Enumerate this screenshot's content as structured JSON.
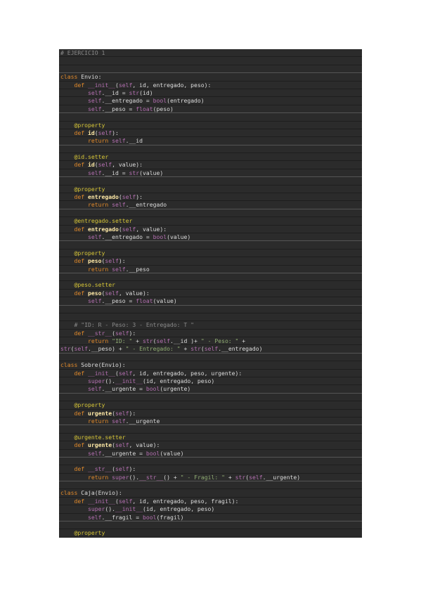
{
  "code_lines": [
    [
      {
        "t": "# EJERCICIO 1",
        "c": "cm"
      }
    ],
    [],
    [],
    [
      {
        "t": "class ",
        "c": "kw"
      },
      {
        "t": "Envio",
        "c": "txt"
      },
      {
        "t": ":",
        "c": "txt"
      }
    ],
    [
      {
        "t": "    def ",
        "c": "kw"
      },
      {
        "t": "__init__",
        "c": "dunder"
      },
      {
        "t": "(",
        "c": "txt"
      },
      {
        "t": "self",
        "c": "self"
      },
      {
        "t": ", id, entregado, peso):",
        "c": "txt"
      }
    ],
    [
      {
        "t": "        ",
        "c": "txt"
      },
      {
        "t": "self",
        "c": "self"
      },
      {
        "t": ".__id = ",
        "c": "txt"
      },
      {
        "t": "str",
        "c": "bi"
      },
      {
        "t": "(id)",
        "c": "txt"
      }
    ],
    [
      {
        "t": "        ",
        "c": "txt"
      },
      {
        "t": "self",
        "c": "self"
      },
      {
        "t": ".__entregado = ",
        "c": "txt"
      },
      {
        "t": "bool",
        "c": "bi"
      },
      {
        "t": "(entregado)",
        "c": "txt"
      }
    ],
    [
      {
        "t": "        ",
        "c": "txt"
      },
      {
        "t": "self",
        "c": "self"
      },
      {
        "t": ".__peso = ",
        "c": "txt"
      },
      {
        "t": "float",
        "c": "bi"
      },
      {
        "t": "(peso)",
        "c": "txt"
      }
    ],
    [],
    [
      {
        "t": "    @property",
        "c": "dec"
      }
    ],
    [
      {
        "t": "    def ",
        "c": "kw"
      },
      {
        "t": "id",
        "c": "fn"
      },
      {
        "t": "(",
        "c": "txt"
      },
      {
        "t": "self",
        "c": "self"
      },
      {
        "t": "):",
        "c": "txt"
      }
    ],
    [
      {
        "t": "        return ",
        "c": "kw"
      },
      {
        "t": "self",
        "c": "self"
      },
      {
        "t": ".__id",
        "c": "txt"
      }
    ],
    [],
    [
      {
        "t": "    @id.setter",
        "c": "dec"
      }
    ],
    [
      {
        "t": "    def ",
        "c": "kw"
      },
      {
        "t": "id",
        "c": "fn"
      },
      {
        "t": "(",
        "c": "txt"
      },
      {
        "t": "self",
        "c": "self"
      },
      {
        "t": ", value):",
        "c": "txt"
      }
    ],
    [
      {
        "t": "        ",
        "c": "txt"
      },
      {
        "t": "self",
        "c": "self"
      },
      {
        "t": ".__id = ",
        "c": "txt"
      },
      {
        "t": "str",
        "c": "bi"
      },
      {
        "t": "(value)",
        "c": "txt"
      }
    ],
    [],
    [
      {
        "t": "    @property",
        "c": "dec"
      }
    ],
    [
      {
        "t": "    def ",
        "c": "kw"
      },
      {
        "t": "entregado",
        "c": "fn"
      },
      {
        "t": "(",
        "c": "txt"
      },
      {
        "t": "self",
        "c": "self"
      },
      {
        "t": "):",
        "c": "txt"
      }
    ],
    [
      {
        "t": "        return ",
        "c": "kw"
      },
      {
        "t": "self",
        "c": "self"
      },
      {
        "t": ".__entregado",
        "c": "txt"
      }
    ],
    [],
    [
      {
        "t": "    @entregado.setter",
        "c": "dec"
      }
    ],
    [
      {
        "t": "    def ",
        "c": "kw"
      },
      {
        "t": "entregado",
        "c": "fn"
      },
      {
        "t": "(",
        "c": "txt"
      },
      {
        "t": "self",
        "c": "self"
      },
      {
        "t": ", value):",
        "c": "txt"
      }
    ],
    [
      {
        "t": "        ",
        "c": "txt"
      },
      {
        "t": "self",
        "c": "self"
      },
      {
        "t": ".__entregado = ",
        "c": "txt"
      },
      {
        "t": "bool",
        "c": "bi"
      },
      {
        "t": "(value)",
        "c": "txt"
      }
    ],
    [],
    [
      {
        "t": "    @property",
        "c": "dec"
      }
    ],
    [
      {
        "t": "    def ",
        "c": "kw"
      },
      {
        "t": "peso",
        "c": "fn"
      },
      {
        "t": "(",
        "c": "txt"
      },
      {
        "t": "self",
        "c": "self"
      },
      {
        "t": "):",
        "c": "txt"
      }
    ],
    [
      {
        "t": "        return ",
        "c": "kw"
      },
      {
        "t": "self",
        "c": "self"
      },
      {
        "t": ".__peso",
        "c": "txt"
      }
    ],
    [],
    [
      {
        "t": "    @peso.setter",
        "c": "dec"
      }
    ],
    [
      {
        "t": "    def ",
        "c": "kw"
      },
      {
        "t": "peso",
        "c": "fn"
      },
      {
        "t": "(",
        "c": "txt"
      },
      {
        "t": "self",
        "c": "self"
      },
      {
        "t": ", value):",
        "c": "txt"
      }
    ],
    [
      {
        "t": "        ",
        "c": "txt"
      },
      {
        "t": "self",
        "c": "self"
      },
      {
        "t": ".__peso = ",
        "c": "txt"
      },
      {
        "t": "float",
        "c": "bi"
      },
      {
        "t": "(value)",
        "c": "txt"
      }
    ],
    [],
    [],
    [
      {
        "t": "    # \"ID: R - Peso: 3 - Entregado: T \"",
        "c": "cm"
      }
    ],
    [
      {
        "t": "    def ",
        "c": "kw"
      },
      {
        "t": "__str__",
        "c": "dunder"
      },
      {
        "t": "(",
        "c": "txt"
      },
      {
        "t": "self",
        "c": "self"
      },
      {
        "t": "):",
        "c": "txt"
      }
    ],
    [
      {
        "t": "        return ",
        "c": "kw"
      },
      {
        "t": "\"ID: \"",
        "c": "str"
      },
      {
        "t": " + ",
        "c": "txt"
      },
      {
        "t": "str",
        "c": "bi"
      },
      {
        "t": "(",
        "c": "txt"
      },
      {
        "t": "self",
        "c": "self"
      },
      {
        "t": ".__id )+ ",
        "c": "txt"
      },
      {
        "t": "\" - Peso: \"",
        "c": "str"
      },
      {
        "t": " +",
        "c": "txt"
      }
    ],
    [
      {
        "t": "str",
        "c": "bi"
      },
      {
        "t": "(",
        "c": "txt"
      },
      {
        "t": "self",
        "c": "self"
      },
      {
        "t": ".__peso) + ",
        "c": "txt"
      },
      {
        "t": "\" - Entregado: \"",
        "c": "str"
      },
      {
        "t": " + ",
        "c": "txt"
      },
      {
        "t": "str",
        "c": "bi"
      },
      {
        "t": "(",
        "c": "txt"
      },
      {
        "t": "self",
        "c": "self"
      },
      {
        "t": ".__entregado)",
        "c": "txt"
      }
    ],
    [],
    [
      {
        "t": "class ",
        "c": "kw"
      },
      {
        "t": "Sobre(Envio):",
        "c": "txt"
      }
    ],
    [
      {
        "t": "    def ",
        "c": "kw"
      },
      {
        "t": "__init__",
        "c": "dunder"
      },
      {
        "t": "(",
        "c": "txt"
      },
      {
        "t": "self",
        "c": "self"
      },
      {
        "t": ", id, entregado, peso, urgente):",
        "c": "txt"
      }
    ],
    [
      {
        "t": "        ",
        "c": "txt"
      },
      {
        "t": "super",
        "c": "bi"
      },
      {
        "t": "().",
        "c": "txt"
      },
      {
        "t": "__init__",
        "c": "dunder"
      },
      {
        "t": "(id, entregado, peso)",
        "c": "txt"
      }
    ],
    [
      {
        "t": "        ",
        "c": "txt"
      },
      {
        "t": "self",
        "c": "self"
      },
      {
        "t": ".__urgente = ",
        "c": "txt"
      },
      {
        "t": "bool",
        "c": "bi"
      },
      {
        "t": "(urgente)",
        "c": "txt"
      }
    ],
    [],
    [
      {
        "t": "    @property",
        "c": "dec"
      }
    ],
    [
      {
        "t": "    def ",
        "c": "kw"
      },
      {
        "t": "urgente",
        "c": "fn"
      },
      {
        "t": "(",
        "c": "txt"
      },
      {
        "t": "self",
        "c": "self"
      },
      {
        "t": "):",
        "c": "txt"
      }
    ],
    [
      {
        "t": "        return ",
        "c": "kw"
      },
      {
        "t": "self",
        "c": "self"
      },
      {
        "t": ".__urgente",
        "c": "txt"
      }
    ],
    [],
    [
      {
        "t": "    @urgente.setter",
        "c": "dec"
      }
    ],
    [
      {
        "t": "    def ",
        "c": "kw"
      },
      {
        "t": "urgente",
        "c": "fn"
      },
      {
        "t": "(",
        "c": "txt"
      },
      {
        "t": "self",
        "c": "self"
      },
      {
        "t": ", value):",
        "c": "txt"
      }
    ],
    [
      {
        "t": "        ",
        "c": "txt"
      },
      {
        "t": "self",
        "c": "self"
      },
      {
        "t": ".__urgente = ",
        "c": "txt"
      },
      {
        "t": "bool",
        "c": "bi"
      },
      {
        "t": "(value)",
        "c": "txt"
      }
    ],
    [],
    [
      {
        "t": "    def ",
        "c": "kw"
      },
      {
        "t": "__str__",
        "c": "dunder"
      },
      {
        "t": "(",
        "c": "txt"
      },
      {
        "t": "self",
        "c": "self"
      },
      {
        "t": "):",
        "c": "txt"
      }
    ],
    [
      {
        "t": "        return ",
        "c": "kw"
      },
      {
        "t": "super",
        "c": "bi"
      },
      {
        "t": "().",
        "c": "txt"
      },
      {
        "t": "__str__",
        "c": "dunder"
      },
      {
        "t": "() + ",
        "c": "txt"
      },
      {
        "t": "\" - Fragil: \"",
        "c": "str"
      },
      {
        "t": " + ",
        "c": "txt"
      },
      {
        "t": "str",
        "c": "bi"
      },
      {
        "t": "(",
        "c": "txt"
      },
      {
        "t": "self",
        "c": "self"
      },
      {
        "t": ".__urgente)",
        "c": "txt"
      }
    ],
    [],
    [
      {
        "t": "class ",
        "c": "kw"
      },
      {
        "t": "Caja(Envio):",
        "c": "txt"
      }
    ],
    [
      {
        "t": "    def ",
        "c": "kw"
      },
      {
        "t": "__init__",
        "c": "dunder"
      },
      {
        "t": "(",
        "c": "txt"
      },
      {
        "t": "self",
        "c": "self"
      },
      {
        "t": ", id, entregado, peso, fragil):",
        "c": "txt"
      }
    ],
    [
      {
        "t": "        ",
        "c": "txt"
      },
      {
        "t": "super",
        "c": "bi"
      },
      {
        "t": "().",
        "c": "txt"
      },
      {
        "t": "__init__",
        "c": "dunder"
      },
      {
        "t": "(id, entregado, peso)",
        "c": "txt"
      }
    ],
    [
      {
        "t": "        ",
        "c": "txt"
      },
      {
        "t": "self",
        "c": "self"
      },
      {
        "t": ".__fragil = ",
        "c": "txt"
      },
      {
        "t": "bool",
        "c": "bi"
      },
      {
        "t": "(fragil)",
        "c": "txt"
      }
    ],
    [],
    [
      {
        "t": "    @property",
        "c": "dec"
      }
    ]
  ],
  "colors": {
    "background": "#2b2b2b",
    "keyword": "#e0892b",
    "self": "#b36fb0",
    "string": "#90ad73",
    "comment": "#8a8a8a",
    "decorator": "#d7c637"
  }
}
